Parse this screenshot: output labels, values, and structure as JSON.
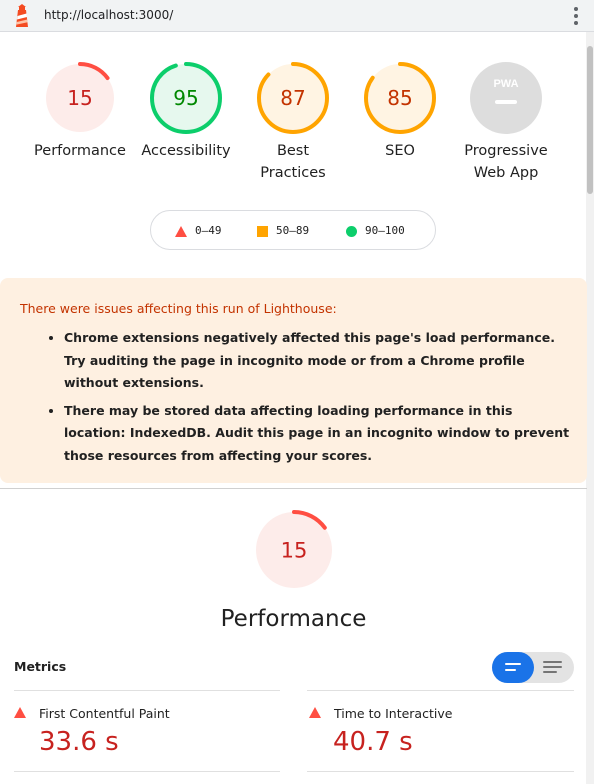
{
  "browser": {
    "url": "http://localhost:3000/"
  },
  "colors": {
    "fail": "#ff4e42",
    "average": "#ffa400",
    "pass": "#0cce6b",
    "na": "#dddddd"
  },
  "categories": [
    {
      "score": "15",
      "label": "Performance",
      "rating": "fail",
      "fraction": 0.15
    },
    {
      "score": "95",
      "label": "Accessibility",
      "rating": "pass",
      "fraction": 0.95
    },
    {
      "score": "87",
      "label_line1": "Best",
      "label_line2": "Practices",
      "rating": "average",
      "fraction": 0.87
    },
    {
      "score": "85",
      "label": "SEO",
      "rating": "average",
      "fraction": 0.85
    },
    {
      "badge": "PWA",
      "label_line1": "Progressive",
      "label_line2": "Web App",
      "rating": "na"
    }
  ],
  "legend": {
    "fail": "0–49",
    "average": "50–89",
    "pass": "90–100"
  },
  "warning": {
    "title": "There were issues affecting this run of Lighthouse:",
    "items": [
      "Chrome extensions negatively affected this page's load performance. Try auditing the page in incognito mode or from a Chrome profile without extensions.",
      "There may be stored data affecting loading performance in this location: IndexedDB. Audit this page in an incognito window to prevent those resources from affecting your scores."
    ]
  },
  "performance": {
    "score": "15",
    "fraction": 0.15,
    "title": "Performance",
    "metrics_label": "Metrics",
    "metrics": [
      {
        "name": "First Contentful Paint",
        "value": "33.6 s"
      },
      {
        "name": "Time to Interactive",
        "value": "40.7 s"
      }
    ]
  }
}
